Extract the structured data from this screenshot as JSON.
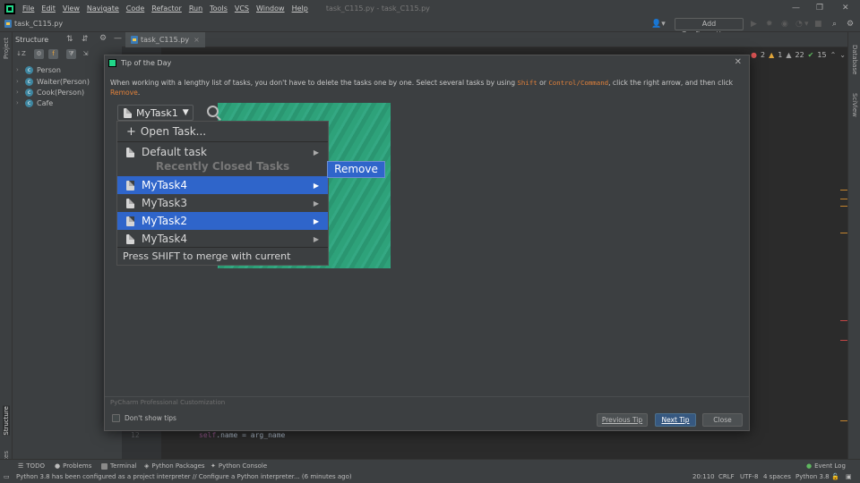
{
  "window": {
    "title": "task_C115.py - task_C115.py",
    "menu": [
      "File",
      "Edit",
      "View",
      "Navigate",
      "Code",
      "Refactor",
      "Run",
      "Tools",
      "VCS",
      "Window",
      "Help"
    ]
  },
  "navbar": {
    "file": "task_C115.py",
    "add_configuration": "Add Configuration..."
  },
  "left_stripe": {
    "project": "Project",
    "structure": "Structure",
    "favorites": "Favorites"
  },
  "right_stripe": {
    "database": "Database",
    "sciview": "SciView"
  },
  "structure": {
    "title": "Structure",
    "items": [
      "Person",
      "Waiter(Person)",
      "Cook(Person)",
      "Cafe"
    ]
  },
  "editor": {
    "tab": "task_C115.py",
    "inspections": {
      "errors": "2",
      "warnings": "1",
      "weak": "22",
      "typos": "15"
    },
    "line_number": "12",
    "code_self": "self",
    "code_rest": ".name = arg_name"
  },
  "dialog": {
    "title": "Tip of the Day",
    "tip_part1": "When working with a lengthy list of tasks, you don't have to delete the tasks one by one. Select several tasks by using ",
    "tip_shift": "Shift",
    "tip_or": " or ",
    "tip_cmd": "Control/Command",
    "tip_part2": ", click the right arrow, and then click ",
    "tip_remove": "Remove",
    "tip_end": ".",
    "image": {
      "combo": "MyTask1",
      "open_task": "Open Task...",
      "default_task": "Default task",
      "recent_header": "Recently Closed Tasks",
      "tasks": [
        "MyTask4",
        "MyTask3",
        "MyTask2",
        "MyTask4"
      ],
      "merge_hint": "Press SHIFT to merge with current context",
      "remove": "Remove"
    },
    "footer_label": "PyCharm Professional Customization",
    "dont_show": "Don't show tips",
    "previous": "Previous Tip",
    "next": "Next Tip",
    "close": "Close"
  },
  "toolwindows": [
    "TODO",
    "Problems",
    "Terminal",
    "Python Packages",
    "Python Console"
  ],
  "event_log": "Event Log",
  "status": {
    "message": "Python 3.8 has been configured as a project interpreter // Configure a Python interpreter... (6 minutes ago)",
    "position": "20:110",
    "line_sep": "CRLF",
    "encoding": "UTF-8",
    "indent": "4 spaces",
    "interpreter": "Python 3.8"
  }
}
